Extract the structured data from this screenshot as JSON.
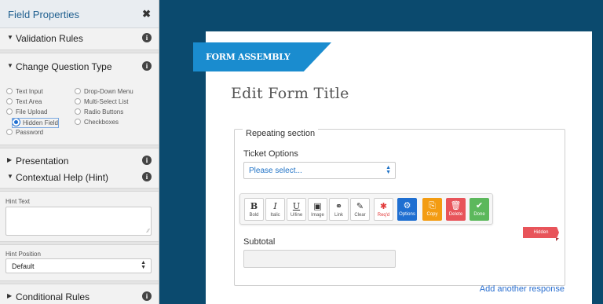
{
  "panel": {
    "title": "Field Properties",
    "close_glyph": "✖",
    "sections": {
      "validation": "Validation Rules",
      "change_type": "Change Question Type",
      "presentation": "Presentation",
      "contextual_help": "Contextual Help (Hint)",
      "conditional": "Conditional Rules"
    },
    "question_types_col1": [
      "Text Input",
      "Text Area",
      "File Upload",
      "Hidden Field",
      "Password"
    ],
    "question_types_col2": [
      "Drop-Down Menu",
      "Multi-Select List",
      "Radio Buttons",
      "Checkboxes"
    ],
    "selected_type": "Hidden Field",
    "hint_text_label": "Hint Text",
    "hint_text_value": "",
    "hint_position_label": "Hint Position",
    "hint_position_value": "Default"
  },
  "form": {
    "brand": "FORM ASSEMBLY",
    "title": "Edit Form Title",
    "section_legend": "Repeating section",
    "question_label": "Ticket Options",
    "dropdown_value": "Please select...",
    "toolbar": [
      {
        "glyph": "B",
        "label": "Bold",
        "color": ""
      },
      {
        "glyph": "I",
        "label": "Italic",
        "color": ""
      },
      {
        "glyph": "U",
        "label": "U/line",
        "color": ""
      },
      {
        "glyph": "▣",
        "label": "Image",
        "color": ""
      },
      {
        "glyph": "⚭",
        "label": "Link",
        "color": ""
      },
      {
        "glyph": "✎",
        "label": "Clear",
        "color": ""
      },
      {
        "glyph": "✱",
        "label": "Req'd",
        "color": "#e23b3b"
      },
      {
        "glyph": "⚙",
        "label": "Options",
        "color": "#1f6fd1"
      },
      {
        "glyph": "⎘",
        "label": "Copy",
        "color": "#f39c12"
      },
      {
        "glyph": "🗑",
        "label": "Delete",
        "color": "#e8545a"
      },
      {
        "glyph": "✔",
        "label": "Done",
        "color": "#5cb85c"
      }
    ],
    "hidden_badge": "Hidden",
    "subtotal_label": "Subtotal",
    "subtotal_value": "",
    "add_response": "Add another response"
  }
}
